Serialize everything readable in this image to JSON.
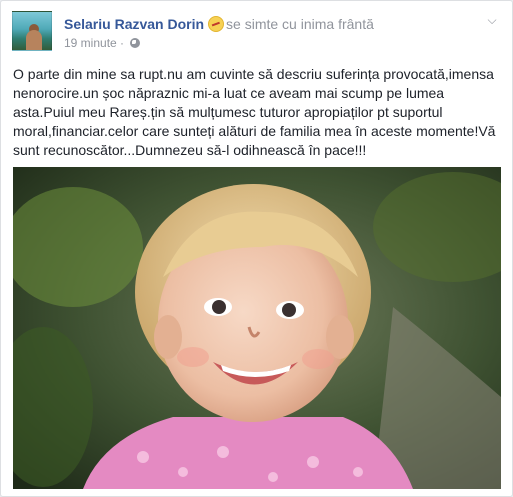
{
  "post": {
    "author": "Selariu Razvan Dorin",
    "feeling": "se simte cu inima frântă",
    "feeling_icon": "broken-heart-emoji",
    "timestamp": "19 minute",
    "separator": "·",
    "privacy_icon": "globe-icon",
    "text": "O parte din mine sa rupt.nu am cuvinte să descriu suferința provocată,imensa nenorocire.un șoc năpraznic mi-a luat ce aveam mai scump pe lumea asta.Puiul meu Rareș.țin să mulțumesc tuturor apropiaților pt suportul moral,financiar.celor care sunteți alături de familia mea în aceste momente!Vă sunt recunoscător...Dumnezeu să-l odihnească în pace!!!",
    "image_subject": "child-photo"
  },
  "colors": {
    "link": "#365899",
    "meta": "#90949c",
    "text": "#1d2129",
    "border": "#dddfe2"
  }
}
